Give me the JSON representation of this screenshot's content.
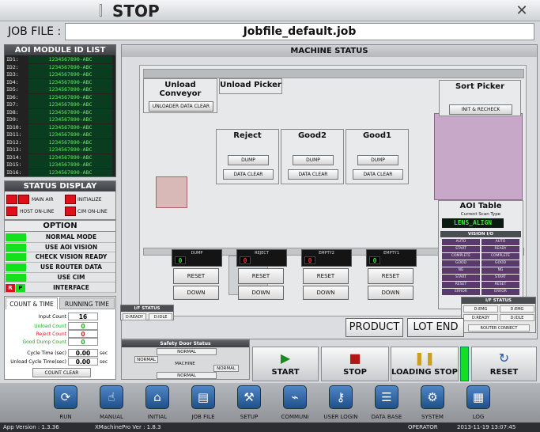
{
  "window": {
    "title": "STOP",
    "close_glyph": "✕"
  },
  "job": {
    "label": "JOB FILE :",
    "value": "Jobfile_default.job"
  },
  "aoi_list": {
    "title": "AOI MODULE ID LIST",
    "ids": [
      "ID1:",
      "ID2:",
      "ID3:",
      "ID4:",
      "ID5:",
      "ID6:",
      "ID7:",
      "ID8:",
      "ID9:",
      "ID10:",
      "ID11:",
      "ID12:",
      "ID13:",
      "ID14:",
      "ID15:",
      "ID16:"
    ],
    "value": "1234567890-ABC"
  },
  "status_display": {
    "title": "STATUS DISPLAY",
    "items": [
      "MAIN AIR",
      "INITIALIZE",
      "HOST ON-LINE",
      "CIM ON-LINE"
    ],
    "color": "#e0101a"
  },
  "option": {
    "title": "OPTION",
    "items": [
      "NORMAL MODE",
      "USE AOI VISION",
      "CHECK VISION READY",
      "USE ROUTER DATA",
      "USE CIM",
      "INTERFACE"
    ],
    "interface_flags": [
      "R",
      "P"
    ],
    "on_color": "#14e01e"
  },
  "count": {
    "tabs": [
      "COUNT & TIME",
      "RUNNING TIME"
    ],
    "rows": [
      {
        "label": "Input Count",
        "value": "16",
        "unit": "",
        "color": "#000000"
      },
      {
        "label": "Unload Count",
        "value": "0",
        "unit": "",
        "color": "#18b018"
      },
      {
        "label": "Reject Count",
        "value": "0",
        "unit": "",
        "color": "#e01818"
      },
      {
        "label": "Good Dump Count",
        "value": "0",
        "unit": "",
        "color": "#18b018"
      },
      {
        "label": "Cycle Time (sec)",
        "value": "0.00",
        "unit": "sec",
        "color": "#000000"
      },
      {
        "label": "Unload Cycle Time(sec)",
        "value": "0.00",
        "unit": "sec",
        "color": "#000000"
      }
    ],
    "clear_label": "COUNT CLEAR"
  },
  "machine": {
    "title": "MACHINE STATUS",
    "unload_conveyor": {
      "title": "Unload Conveyor",
      "button": "UNLOADER DATA CLEAR"
    },
    "unload_picker": {
      "title": "Unload Picker"
    },
    "sort_picker": {
      "title": "Sort Picker",
      "button": "INIT & RECHECK"
    },
    "trays": [
      {
        "title": "Reject",
        "dump": "DUMP",
        "clear": "DATA CLEAR"
      },
      {
        "title": "Good2",
        "dump": "DUMP",
        "clear": "DATA CLEAR"
      },
      {
        "title": "Good1",
        "dump": "DUMP",
        "clear": "DATA CLEAR"
      }
    ],
    "counters": [
      {
        "label": "DUMP",
        "value": "0",
        "red": false,
        "reset": "RESET",
        "down": "DOWN"
      },
      {
        "label": "REJECT",
        "value": "0",
        "red": true,
        "reset": "RESET",
        "down": "DOWN"
      },
      {
        "label": "EMPTY2",
        "value": "0",
        "red": true,
        "reset": "RESET",
        "down": "DOWN"
      },
      {
        "label": "EMPTY1",
        "value": "0",
        "red": false,
        "reset": "RESET",
        "down": "DOWN"
      }
    ],
    "aoi_table": {
      "title": "AOI Table",
      "scan_label": "Current Scan Type",
      "scan_value": "LENS_ALIGN",
      "vision_title": "VISION I/O",
      "vision_rows": [
        [
          "AUTO",
          "AUTO"
        ],
        [
          "START",
          "READY"
        ],
        [
          "COMPLETE",
          "COMPLETE"
        ],
        [
          "GOOD",
          "GOOD"
        ],
        [
          "NG",
          "NG"
        ],
        [
          "START",
          "START"
        ],
        [
          "RESET",
          "RESET"
        ],
        [
          "ERROR",
          "ERROR"
        ]
      ]
    },
    "if_left": {
      "title": "I/F STATUS",
      "cells": [
        "D:READY",
        "D:IDLE"
      ]
    },
    "if_right": {
      "title": "I/F STATUS",
      "cells": [
        "D:EMG",
        "D:EMG",
        "D:READY",
        "D:IDLE"
      ],
      "router": "ROUTER CONNECT"
    },
    "product_label": "PRODUCT",
    "lot_end_label": "LOT END"
  },
  "safety": {
    "title": "Safety Door Status",
    "cells": [
      "NORMAL",
      "NORMAL",
      "MACHINE",
      "NORMAL",
      "NORMAL"
    ]
  },
  "controls": [
    {
      "label": "START",
      "icon": "▶",
      "color": "#1c8a1c"
    },
    {
      "label": "STOP",
      "icon": "■",
      "color": "#b01818"
    },
    {
      "label": "LOADING STOP",
      "icon": "❚❚",
      "color": "#c9a020"
    },
    {
      "label": "RESET",
      "icon": "↻",
      "color": "#1f56b0"
    }
  ],
  "toolbar": [
    {
      "label": "RUN",
      "icon": "⟳",
      "name": "run"
    },
    {
      "label": "MANUAL",
      "icon": "☝",
      "name": "manual"
    },
    {
      "label": "INITIAL",
      "icon": "⌂",
      "name": "initial"
    },
    {
      "label": "JOB FILE",
      "icon": "▤",
      "name": "job-file"
    },
    {
      "label": "SETUP",
      "icon": "⚒",
      "name": "setup"
    },
    {
      "label": "COMMUNI",
      "icon": "⌁",
      "name": "communi"
    },
    {
      "label": "USER LOGIN",
      "icon": "⚷",
      "name": "user-login"
    },
    {
      "label": "DATA BASE",
      "icon": "☰",
      "name": "data-base"
    },
    {
      "label": "SYSTEM",
      "icon": "⚙",
      "name": "system"
    },
    {
      "label": "LOG",
      "icon": "▦",
      "name": "log"
    }
  ],
  "status_bar": {
    "app_version": "App Version : 1.3.36",
    "xmachine_version": "XMachinePro Ver : 1.8.3",
    "user": "OPERATOR",
    "datetime": "2013-11-19 13:07:45"
  }
}
